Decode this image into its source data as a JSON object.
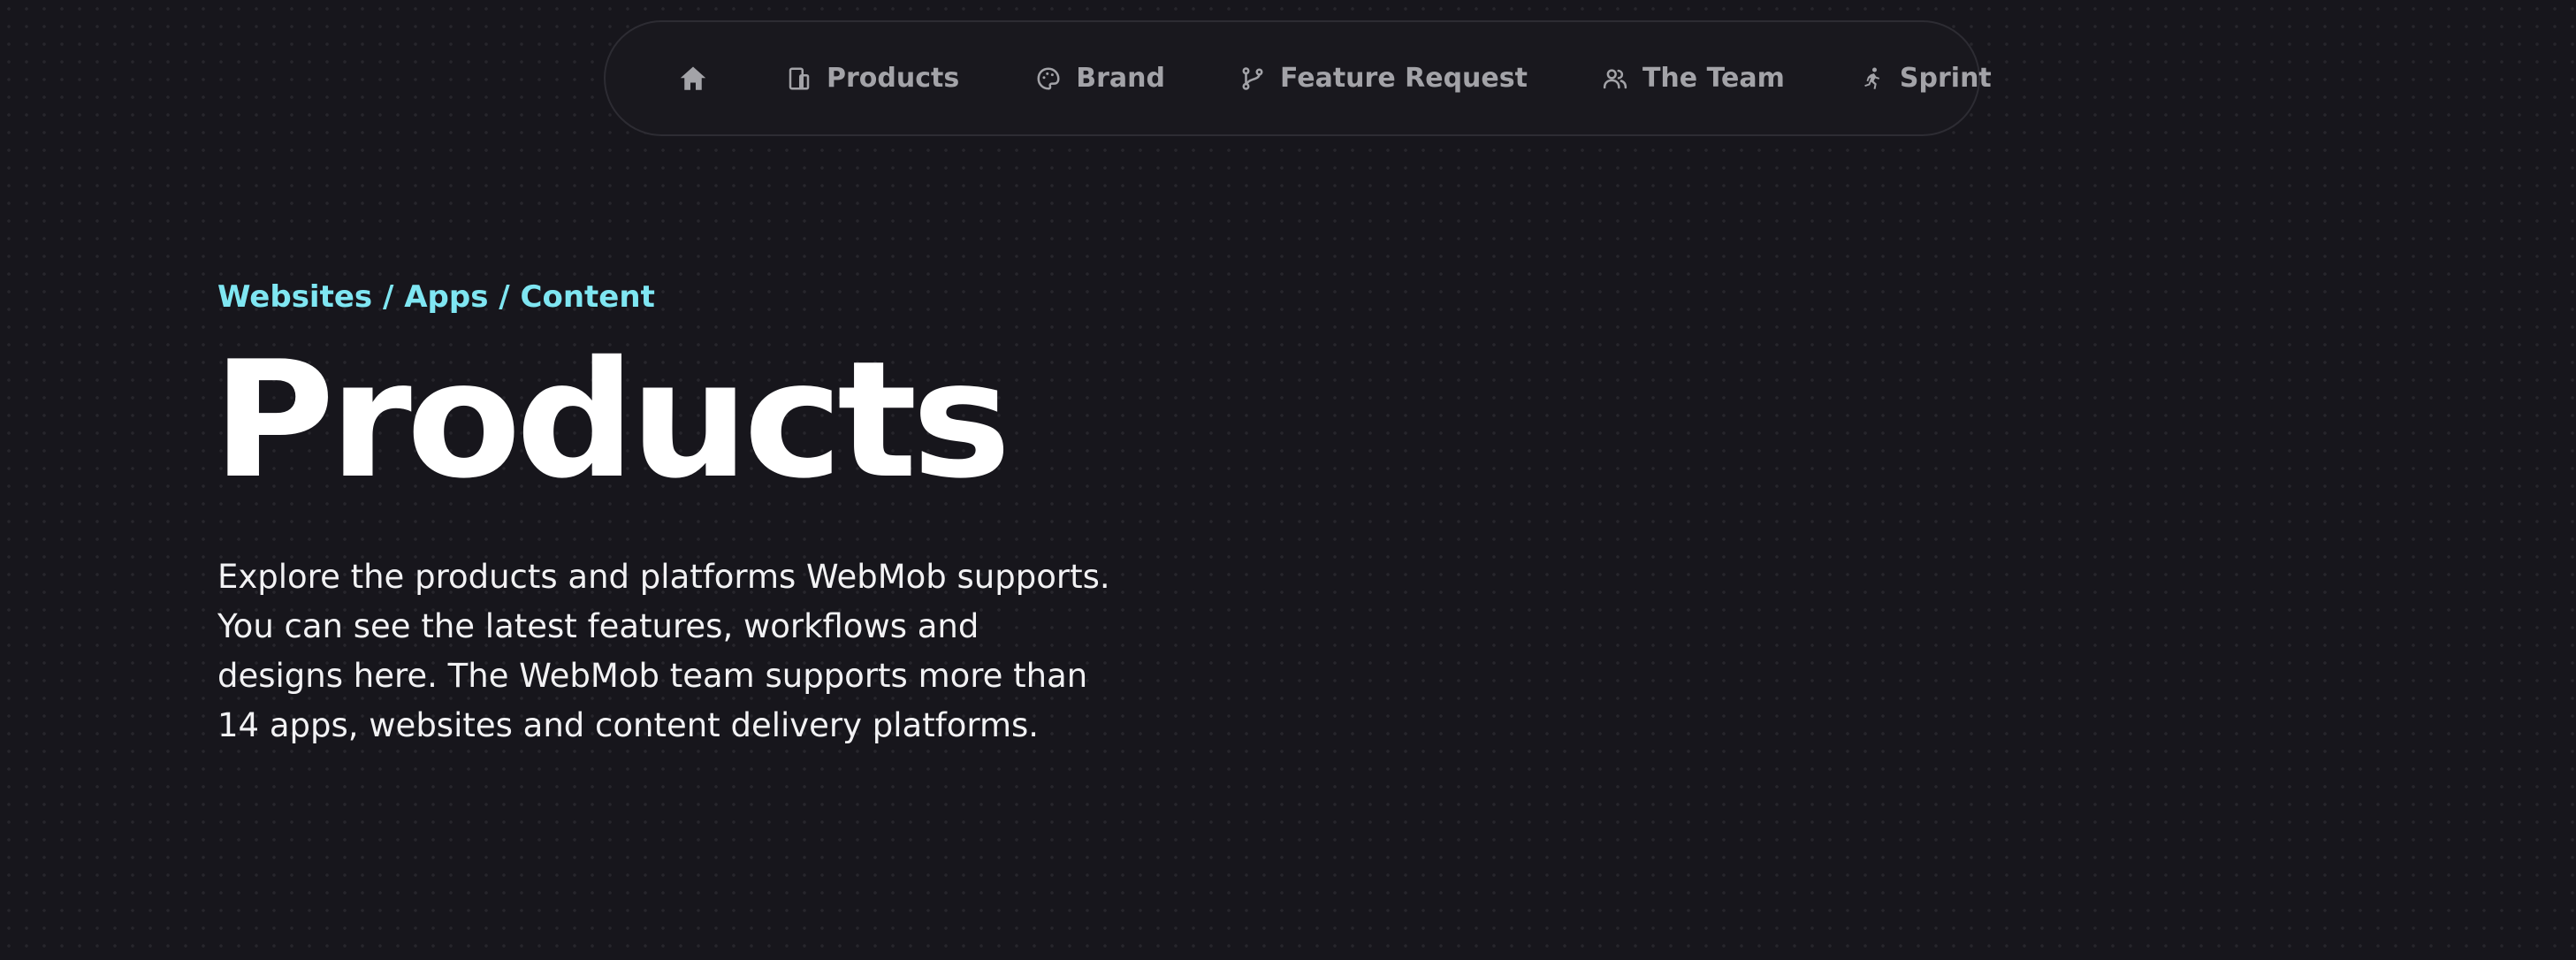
{
  "nav": {
    "items": [
      {
        "label": "",
        "icon": "home-icon"
      },
      {
        "label": "Products",
        "icon": "products-icon"
      },
      {
        "label": "Brand",
        "icon": "palette-icon"
      },
      {
        "label": "Feature Request",
        "icon": "git-branch-icon"
      },
      {
        "label": "The Team",
        "icon": "users-icon"
      },
      {
        "label": "Sprint",
        "icon": "running-icon"
      }
    ]
  },
  "hero": {
    "eyebrow": "Websites / Apps / Content",
    "title": "Products",
    "intro": "Explore the products and platforms WebMob supports. You can see the latest features, workflows and designs here. The WebMob team supports more than 14 apps, websites and content delivery platforms."
  },
  "colors": {
    "background": "#17161c",
    "nav_text": "#a3a3a8",
    "accent": "#7fe6f2",
    "title": "#ffffff"
  }
}
